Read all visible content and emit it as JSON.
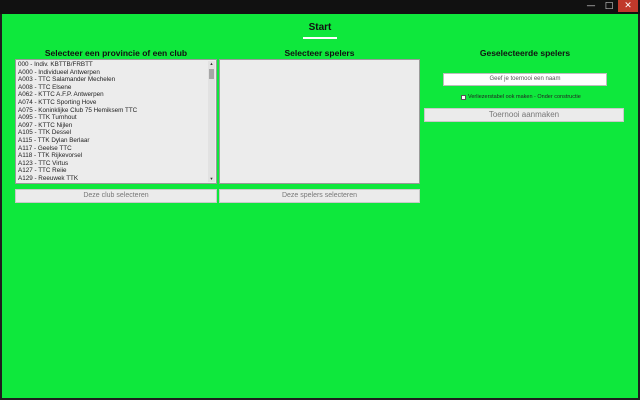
{
  "window": {
    "minimize_glyph": "—",
    "maximize_glyph": "□",
    "close_glyph": "✕"
  },
  "header": {
    "title": "Start"
  },
  "clubs": {
    "title": "Selecteer een provincie of een club",
    "items": [
      "000 - Indiv. KBTTB/FRBTT",
      "A000 - Individueel Antwerpen",
      "A003 - TTC Salamander Mechelen",
      "A008 - TTC Elsene",
      "A062 - KTTC A.F.P. Antwerpen",
      "A074 - KTTC Sporting Hove",
      "A075 - Koninklijke Club 75 Hemiksem TTC",
      "A095 - TTK Turnhout",
      "A097 - KTTC Nijlen",
      "A105 - TTK Dessel",
      "A115 - TTK Dylan Berlaar",
      "A117 - Geelse TTC",
      "A118 - TTK Rijkevorsel",
      "A123 - TTC Virtus",
      "A127 - TTC Reiie",
      "A129 - Reeuwek TTK"
    ],
    "button": "Deze club selecteren"
  },
  "players": {
    "title": "Selecteer spelers",
    "items": [],
    "button": "Deze spelers selecteren"
  },
  "selected": {
    "title": "Geselecteerde spelers",
    "name_placeholder": "Geef je toernooi een naam",
    "checkbox_label": "Verliezerstabel ook maken - Onder constructie",
    "checkbox_checked": false,
    "create_button": "Toernooi aanmaken"
  },
  "colors": {
    "background": "#0ee83c",
    "list_bg": "#ececec",
    "button_bg": "#ebebeb"
  }
}
